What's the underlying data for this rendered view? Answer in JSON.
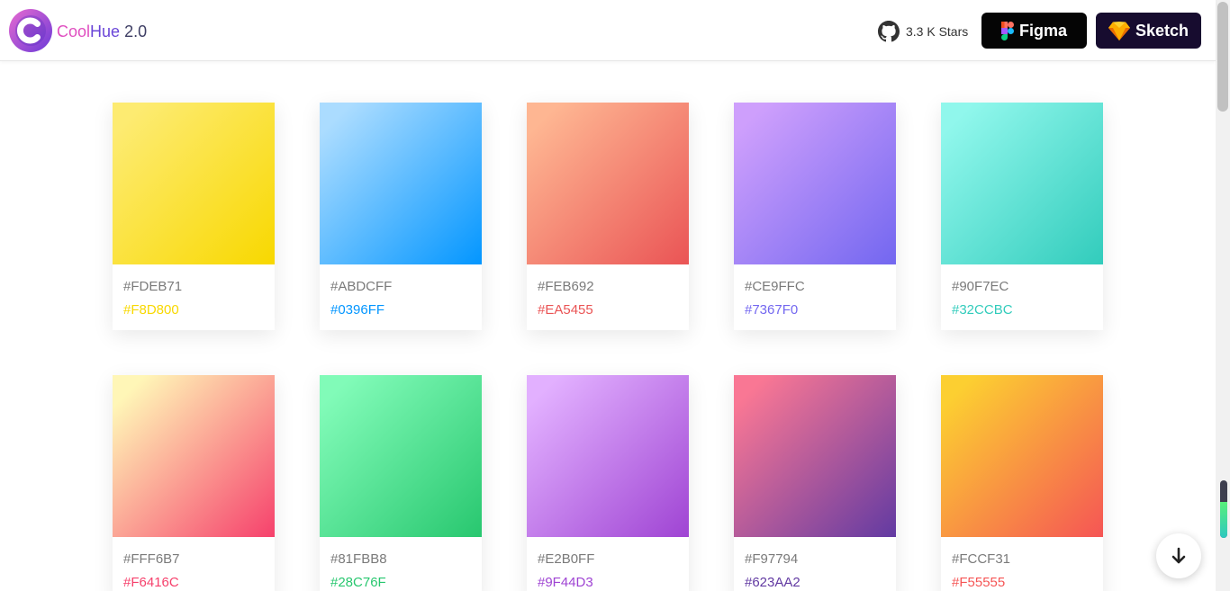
{
  "header": {
    "brand_part1": "Cool",
    "brand_part2": "Hue",
    "brand_version": "2.0",
    "stars_label": "3.3 K Stars",
    "figma_label": "Figma",
    "sketch_label": "Sketch"
  },
  "icons": {
    "logo": "coolhue-logo",
    "github": "github-icon",
    "figma": "figma-icon",
    "sketch": "sketch-icon",
    "scroll_down": "arrow-down-icon"
  },
  "colors": {
    "brand_pink": "#e04fc0",
    "brand_purple": "#6a45d8",
    "figma_bg": "#050505",
    "sketch_bg": "#170c2f"
  },
  "gradients": [
    {
      "from": "#FDEB71",
      "to": "#F8D800"
    },
    {
      "from": "#ABDCFF",
      "to": "#0396FF"
    },
    {
      "from": "#FEB692",
      "to": "#EA5455"
    },
    {
      "from": "#CE9FFC",
      "to": "#7367F0"
    },
    {
      "from": "#90F7EC",
      "to": "#32CCBC"
    },
    {
      "from": "#FFF6B7",
      "to": "#F6416C"
    },
    {
      "from": "#81FBB8",
      "to": "#28C76F"
    },
    {
      "from": "#E2B0FF",
      "to": "#9F44D3"
    },
    {
      "from": "#F97794",
      "to": "#623AA2"
    },
    {
      "from": "#FCCF31",
      "to": "#F55555"
    }
  ]
}
